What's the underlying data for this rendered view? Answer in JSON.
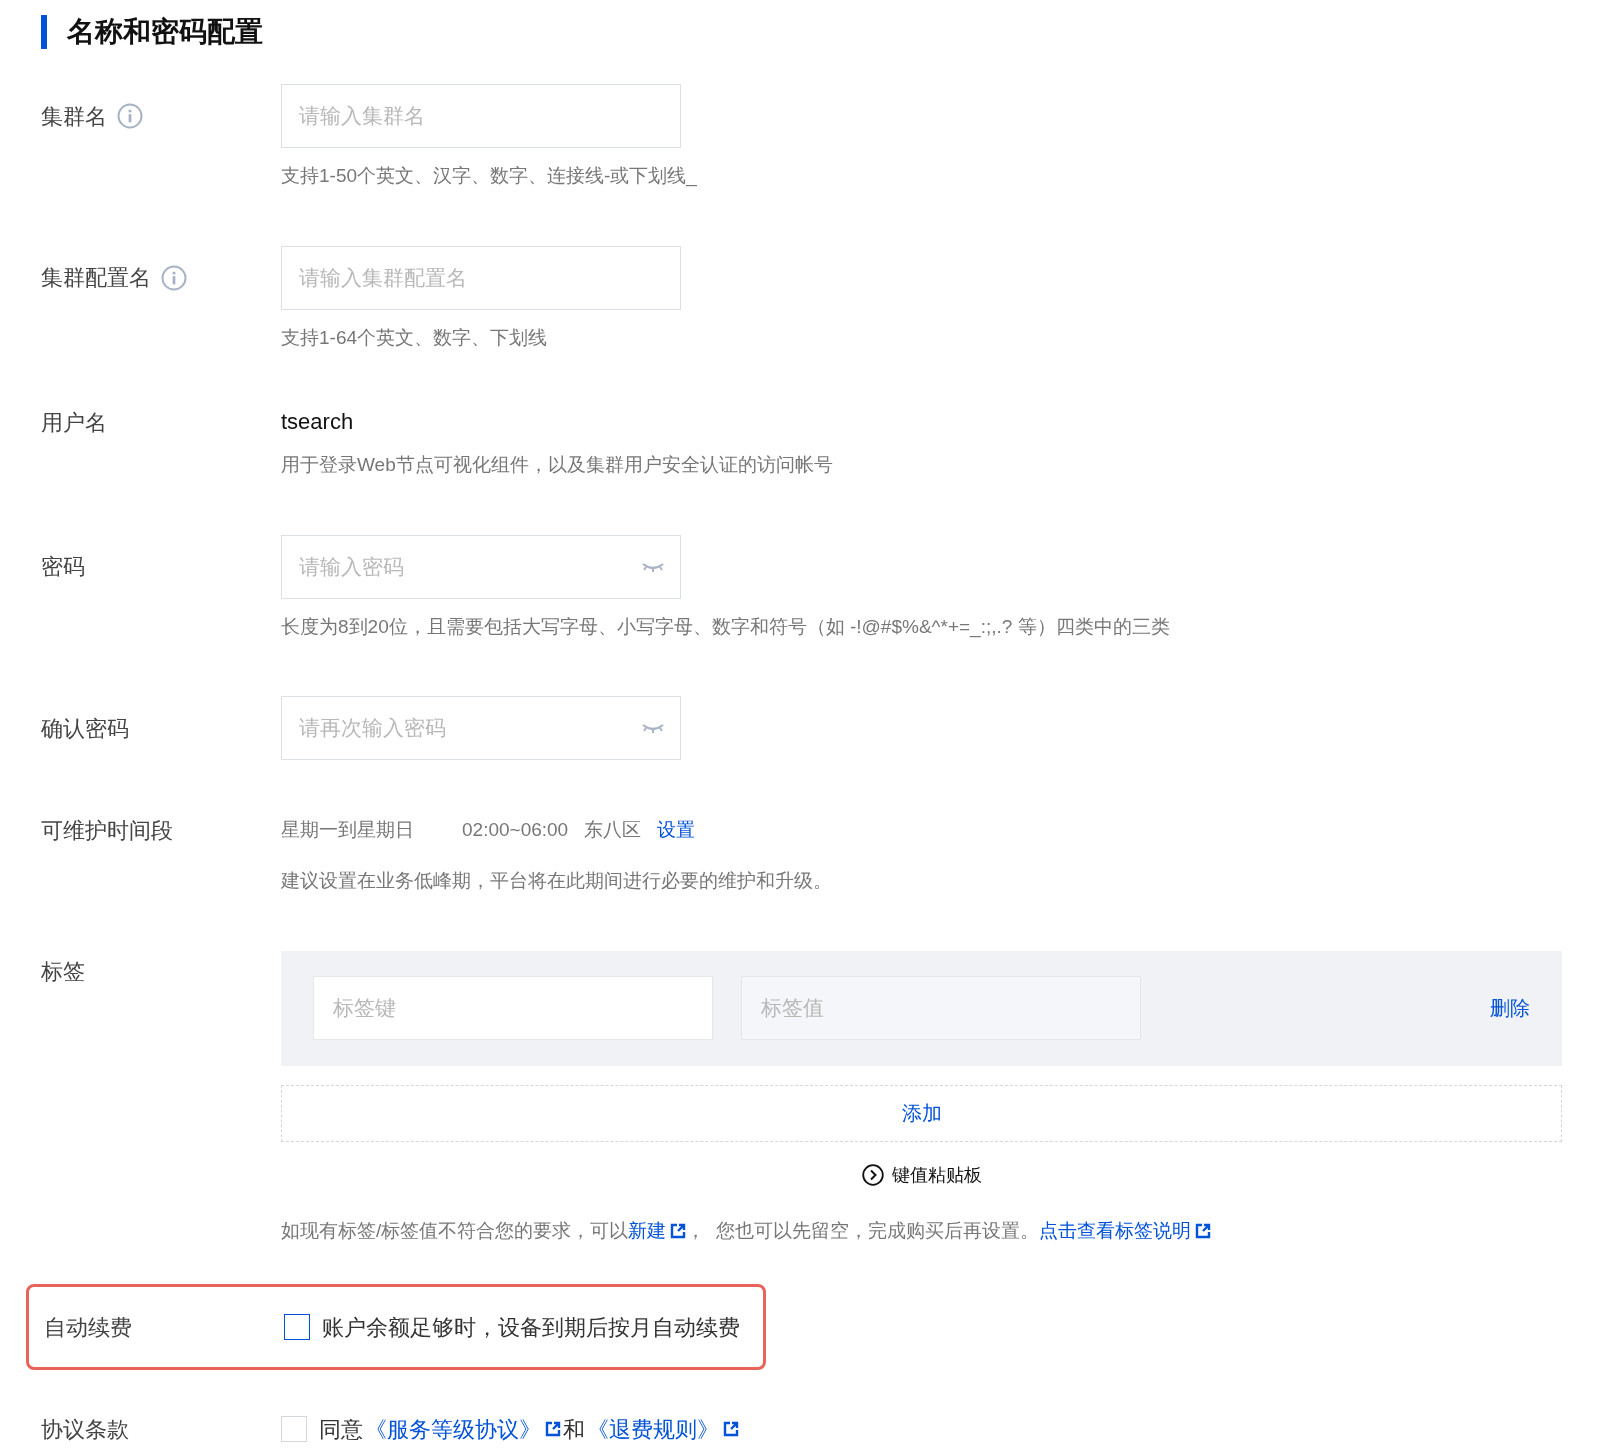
{
  "section_title": "名称和密码配置",
  "fields": [
    {
      "kind": "input",
      "label": "集群名",
      "info": true,
      "placeholder": "请输入集群名",
      "hint": "支持1-50个英文、汉字、数字、连接线-或下划线_"
    },
    {
      "kind": "input",
      "label": "集群配置名",
      "info": true,
      "placeholder": "请输入集群配置名",
      "hint": "支持1-64个英文、数字、下划线"
    },
    {
      "kind": "text",
      "label": "用户名",
      "value": "tsearch",
      "hint": "用于登录Web节点可视化组件，以及集群用户安全认证的访问帐号"
    },
    {
      "kind": "password",
      "label": "密码",
      "placeholder": "请输入密码",
      "hint": "长度为8到20位，且需要包括大写字母、小写字母、数字和符号（如 -!@#$%&^*+=_:;,.? 等）四类中的三类"
    },
    {
      "kind": "password",
      "label": "确认密码",
      "placeholder": "请再次输入密码"
    },
    {
      "kind": "maintenance",
      "label": "可维护时间段",
      "days": "星期一到星期日",
      "time": "02:00~06:00",
      "zone": "东八区",
      "link": "设置",
      "hint": "建议设置在业务低峰期，平台将在此期间进行必要的维护和升级。"
    },
    {
      "kind": "tags",
      "label": "标签",
      "key_placeholder": "标签键",
      "value_placeholder": "标签值",
      "delete": "删除",
      "add": "添加",
      "paste": "键值粘贴板",
      "note": [
        {
          "kind": "text",
          "text": "如现有标签/标签值不符合您的要求，可以"
        },
        {
          "kind": "link",
          "text": "新建"
        },
        {
          "kind": "text",
          "text": "，  您也可以先留空，完成购买后再设置。"
        },
        {
          "kind": "link",
          "text": "点击查看标签说明"
        }
      ]
    },
    {
      "kind": "checkbox",
      "label": "自动续费",
      "highlighted": true,
      "checked": false,
      "parts": [
        {
          "kind": "text",
          "text": "账户余额足够时，设备到期后按月自动续费"
        }
      ]
    },
    {
      "kind": "checkbox",
      "label": "协议条款",
      "highlighted": false,
      "checked": false,
      "parts": [
        {
          "kind": "text",
          "text": "同意"
        },
        {
          "kind": "link",
          "text": "《服务等级协议》"
        },
        {
          "kind": "text",
          "text": "和"
        },
        {
          "kind": "link",
          "text": "《退费规则》"
        }
      ]
    }
  ]
}
